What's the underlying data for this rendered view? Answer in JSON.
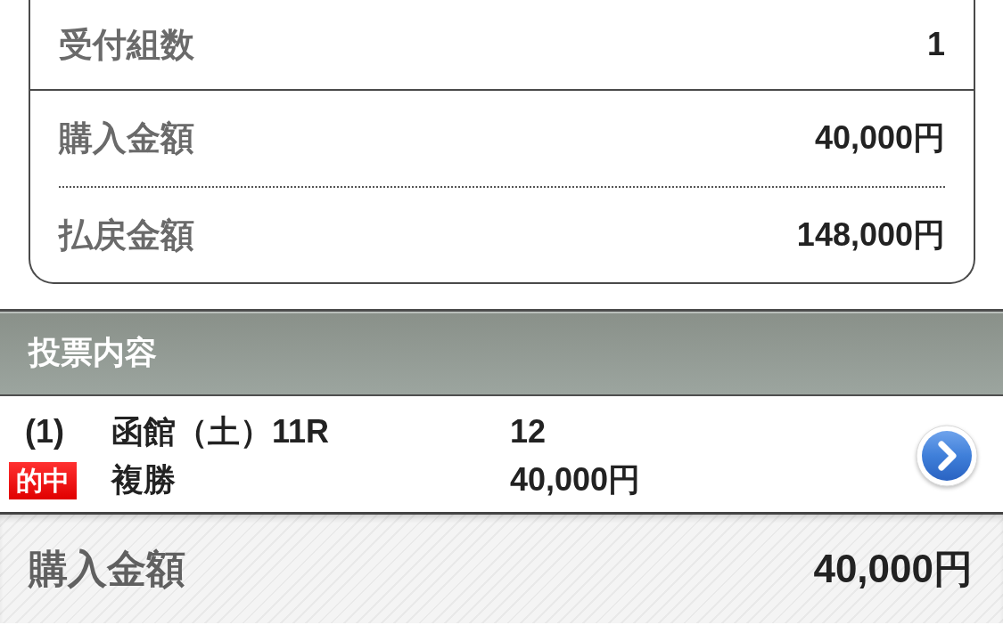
{
  "summary": {
    "count": {
      "label": "受付組数",
      "value": "1"
    },
    "amounts": [
      {
        "label": "購入金額",
        "value": "40,000円"
      },
      {
        "label": "払戻金額",
        "value": "148,000円"
      }
    ]
  },
  "section_header": {
    "title": "投票内容"
  },
  "bets": [
    {
      "number": "(1)",
      "race": "函館（土）11R",
      "selection": "12",
      "bet_type": "複勝",
      "amount": "40,000円",
      "hit": true,
      "hit_label": "的中"
    }
  ],
  "total": {
    "label": "購入金額",
    "value": "40,000円"
  }
}
